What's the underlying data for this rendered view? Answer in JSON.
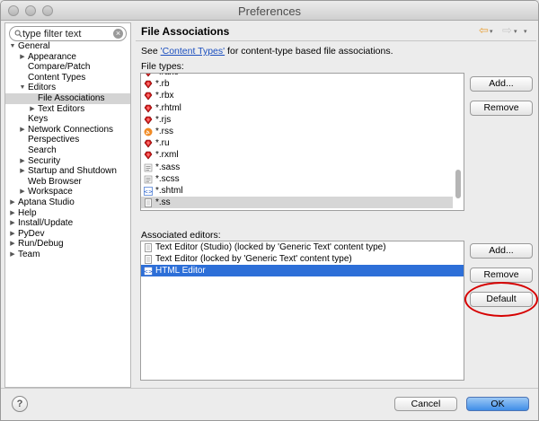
{
  "window": {
    "title": "Preferences"
  },
  "search": {
    "value": "type filter text"
  },
  "tree": [
    {
      "label": "General",
      "level": 0,
      "twisty": "open"
    },
    {
      "label": "Appearance",
      "level": 1,
      "twisty": "closed"
    },
    {
      "label": "Compare/Patch",
      "level": 1,
      "twisty": ""
    },
    {
      "label": "Content Types",
      "level": 1,
      "twisty": ""
    },
    {
      "label": "Editors",
      "level": 1,
      "twisty": "open"
    },
    {
      "label": "File Associations",
      "level": 2,
      "twisty": "",
      "selected": true
    },
    {
      "label": "Text Editors",
      "level": 2,
      "twisty": "closed"
    },
    {
      "label": "Keys",
      "level": 1,
      "twisty": ""
    },
    {
      "label": "Network Connections",
      "level": 1,
      "twisty": "closed"
    },
    {
      "label": "Perspectives",
      "level": 1,
      "twisty": ""
    },
    {
      "label": "Search",
      "level": 1,
      "twisty": ""
    },
    {
      "label": "Security",
      "level": 1,
      "twisty": "closed"
    },
    {
      "label": "Startup and Shutdown",
      "level": 1,
      "twisty": "closed"
    },
    {
      "label": "Web Browser",
      "level": 1,
      "twisty": ""
    },
    {
      "label": "Workspace",
      "level": 1,
      "twisty": "closed"
    },
    {
      "label": "Aptana Studio",
      "level": 0,
      "twisty": "closed"
    },
    {
      "label": "Help",
      "level": 0,
      "twisty": "closed"
    },
    {
      "label": "Install/Update",
      "level": 0,
      "twisty": "closed"
    },
    {
      "label": "PyDev",
      "level": 0,
      "twisty": "closed"
    },
    {
      "label": "Run/Debug",
      "level": 0,
      "twisty": "closed"
    },
    {
      "label": "Team",
      "level": 0,
      "twisty": "closed"
    }
  ],
  "page": {
    "title": "File Associations",
    "see_prefix": "See ",
    "see_link": "'Content Types'",
    "see_suffix": " for content-type based file associations.",
    "file_types_label": "File types:",
    "associated_editors_label": "Associated editors:"
  },
  "file_types": [
    {
      "name": "*.rake",
      "icon": "ruby-gem-icon"
    },
    {
      "name": "*.rb",
      "icon": "ruby-gem-icon"
    },
    {
      "name": "*.rbx",
      "icon": "ruby-gem-icon"
    },
    {
      "name": "*.rhtml",
      "icon": "ruby-gem-icon"
    },
    {
      "name": "*.rjs",
      "icon": "ruby-gem-icon"
    },
    {
      "name": "*.rss",
      "icon": "rss-feed-icon"
    },
    {
      "name": "*.ru",
      "icon": "ruby-gem-icon"
    },
    {
      "name": "*.rxml",
      "icon": "ruby-gem-icon"
    },
    {
      "name": "*.sass",
      "icon": "stylesheet-icon"
    },
    {
      "name": "*.scss",
      "icon": "stylesheet-icon"
    },
    {
      "name": "*.shtml",
      "icon": "html-file-icon"
    },
    {
      "name": "*.ss",
      "icon": "text-file-icon",
      "selected": true
    }
  ],
  "editors": [
    {
      "name": "Text Editor (Studio) (locked by 'Generic Text' content type)",
      "icon": "text-editor-icon"
    },
    {
      "name": "Text Editor (locked by 'Generic Text' content type)",
      "icon": "text-editor-icon"
    },
    {
      "name": "HTML Editor",
      "icon": "html-editor-icon",
      "selected": true
    }
  ],
  "buttons": {
    "file_add": "Add...",
    "file_remove": "Remove",
    "editor_add": "Add...",
    "editor_remove": "Remove",
    "editor_default": "Default",
    "cancel": "Cancel",
    "ok": "OK"
  },
  "help": {
    "label": "?"
  },
  "colors": {
    "selection": "#2d6fd8",
    "link": "#1b4fbf",
    "highlight_circle": "#d60000",
    "ok_button": "#3f8ee8"
  }
}
